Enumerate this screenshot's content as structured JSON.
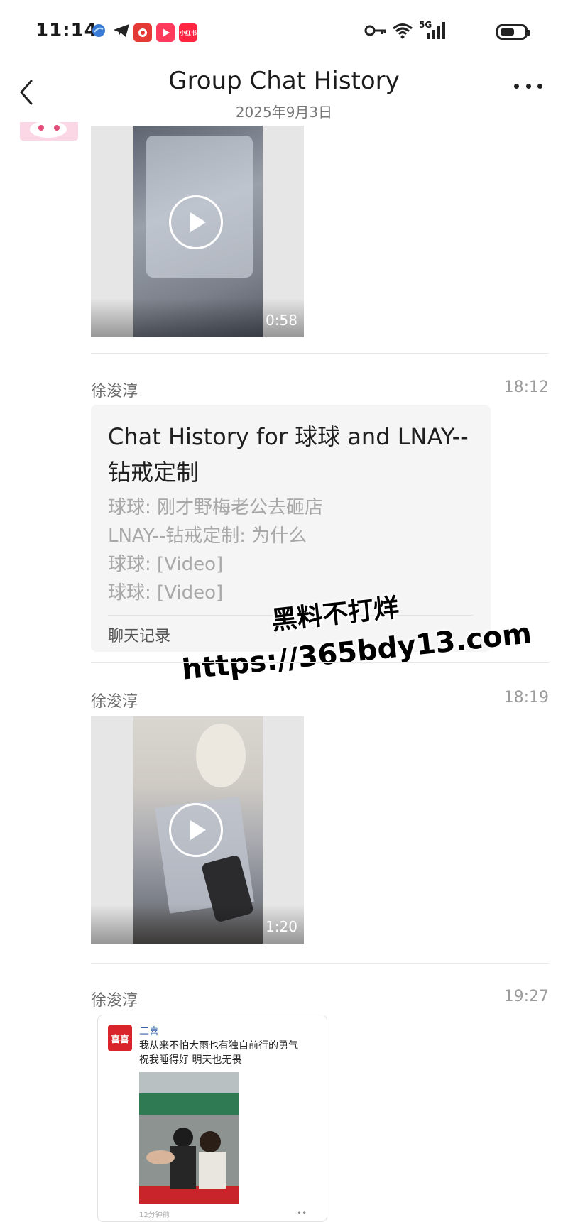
{
  "status_bar": {
    "time": "11:14",
    "network": "5G",
    "app_icons": [
      "blue-app-icon",
      "telegram-icon",
      "red-app-icon",
      "video-app-icon",
      "xiaohongshu-icon"
    ],
    "xiaohongshu_label": "小红书",
    "battery_level": 0.6
  },
  "header": {
    "title": "Group Chat History",
    "date": "2025年9月3日"
  },
  "messages": [
    {
      "type": "video",
      "duration": "0:58"
    },
    {
      "type": "chat_record",
      "sender": "徐浚淳",
      "time": "18:12",
      "card_title": "Chat History for 球球 and LNAY--钻戒定制",
      "lines": [
        "球球: 刚才野梅老公去砸店",
        "LNAY--钻戒定制: 为什么",
        "球球: [Video]",
        "球球: [Video]"
      ],
      "footer": "聊天记录"
    },
    {
      "type": "video",
      "sender": "徐浚淳",
      "time": "18:19",
      "duration": "1:20"
    },
    {
      "type": "share",
      "sender": "徐浚淳",
      "time": "19:27",
      "logo_text": "喜喜",
      "share_name": "二喜",
      "share_text": [
        "我从来不怕大雨也有独自前行的勇气",
        "祝我睡得好 明天也无畏"
      ],
      "share_footer": "12分钟前"
    }
  ],
  "watermark": {
    "line1": "黑料不打烊",
    "line2": "https://365bdy13.com"
  },
  "colors": {
    "background": "#ffffff",
    "card_bg": "#f5f5f5",
    "brand_red": "#d8242a"
  }
}
